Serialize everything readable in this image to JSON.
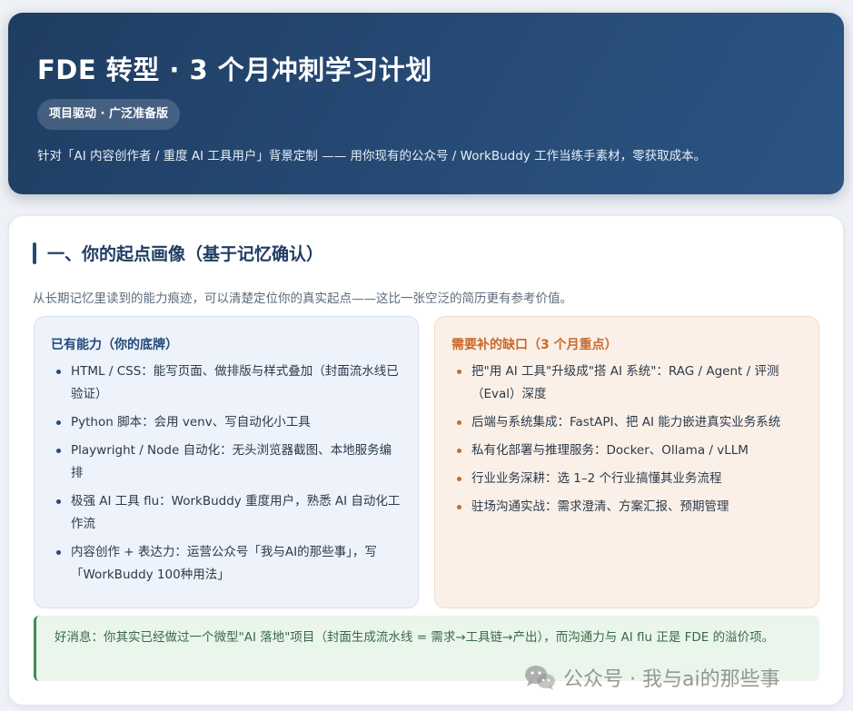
{
  "header": {
    "title": "FDE 转型 · 3 个月冲刺学习计划",
    "badge": "项目驱动 · 广泛准备版",
    "description": "针对「AI 内容创作者 / 重度 AI 工具用户」背景定制 —— 用你现有的公众号 / WorkBuddy 工作当练手素材，零获取成本。"
  },
  "section1": {
    "title": "一、你的起点画像（基于记忆确认）",
    "intro": "从长期记忆里读到的能力痕迹，可以清楚定位你的真实起点——这比一张空泛的简历更有参考价值。",
    "have": {
      "title": "已有能力（你的底牌）",
      "items": [
        "HTML / CSS：能写页面、做排版与样式叠加（封面流水线已验证）",
        "Python 脚本：会用 venv、写自动化小工具",
        "Playwright / Node 自动化：无头浏览器截图、本地服务编排",
        "极强 AI 工具 flu：WorkBuddy 重度用户，熟悉 AI 自动化工作流",
        "内容创作 + 表达力：运营公众号「我与AI的那些事」，写「WorkBuddy 100种用法」"
      ]
    },
    "need": {
      "title": "需要补的缺口（3 个月重点）",
      "items": [
        "把\"用 AI 工具\"升级成\"搭 AI 系统\"：RAG / Agent / 评测（Eval）深度",
        "后端与系统集成：FastAPI、把 AI 能力嵌进真实业务系统",
        "私有化部署与推理服务：Docker、Ollama / vLLM",
        "行业业务深耕：选 1–2 个行业搞懂其业务流程",
        "驻场沟通实战：需求澄清、方案汇报、预期管理"
      ]
    },
    "note": "好消息：你其实已经做过一个微型\"AI 落地\"项目（封面生成流水线 = 需求→工具链→产出），而沟通力与 AI flu 正是 FDE 的溢价项。"
  },
  "watermark": {
    "text": "公众号 · 我与ai的那些事",
    "icon": "wechat-icon"
  }
}
